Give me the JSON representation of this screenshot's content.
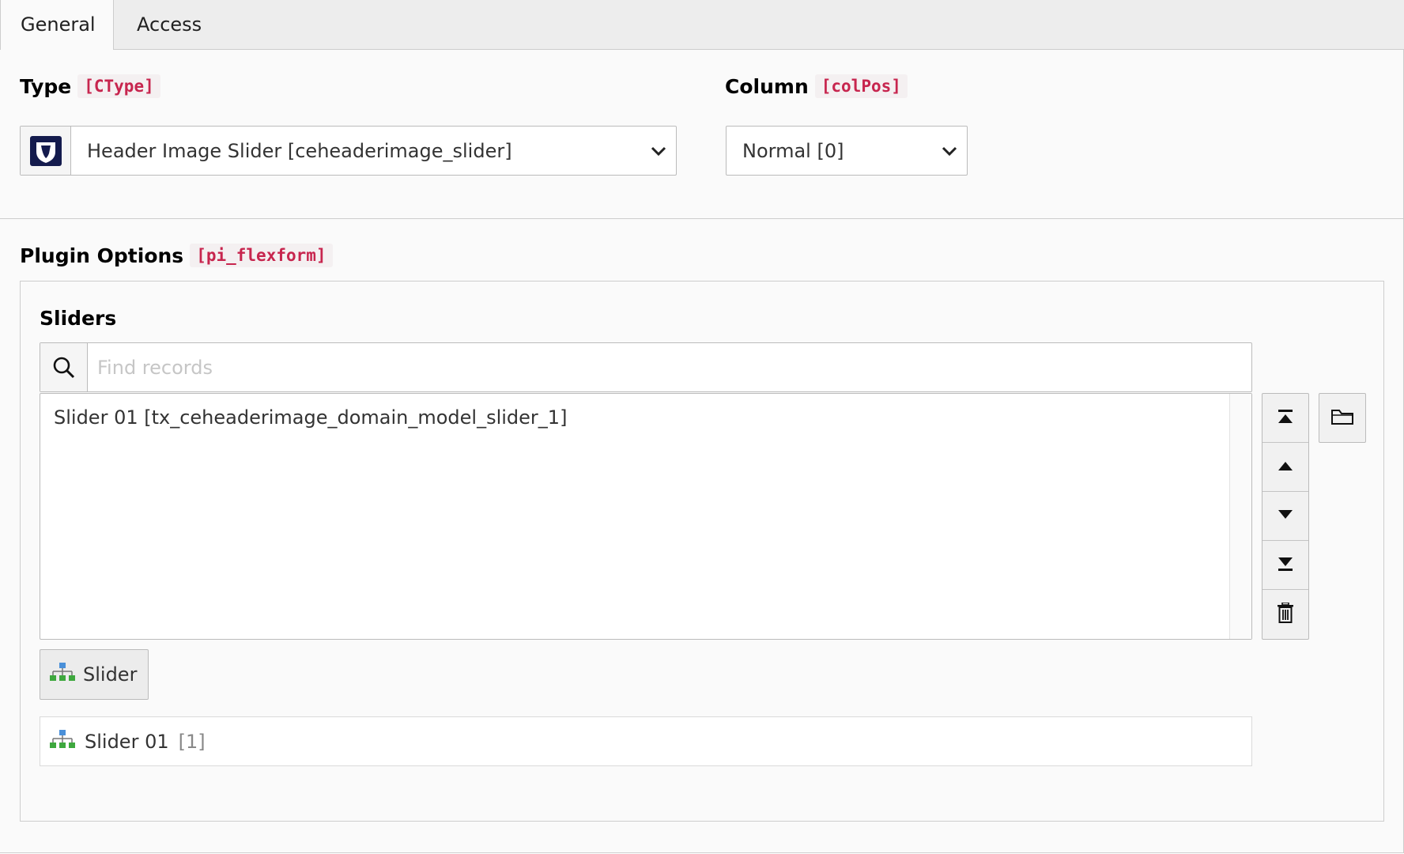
{
  "tabs": [
    {
      "label": "General",
      "active": true
    },
    {
      "label": "Access",
      "active": false
    }
  ],
  "type_field": {
    "label": "Type",
    "code": "[CType]",
    "value": "Header Image Slider [ceheaderimage_slider]",
    "icon": "typo3-shield-icon"
  },
  "column_field": {
    "label": "Column",
    "code": "[colPos]",
    "value": "Normal [0]"
  },
  "plugin_options": {
    "label": "Plugin Options",
    "code": "[pi_flexform]"
  },
  "sliders": {
    "label": "Sliders",
    "search_placeholder": "Find records",
    "selected_items": [
      "Slider 01 [tx_ceheaderimage_domain_model_slider_1]"
    ],
    "controls": [
      "move-to-top-icon",
      "move-up-icon",
      "move-down-icon",
      "move-to-bottom-icon",
      "trash-icon"
    ],
    "browse_icon": "folder-icon",
    "add_button_label": "Slider",
    "records": [
      {
        "title": "Slider 01",
        "uid": "[1]",
        "icon": "sitemap-icon"
      }
    ]
  },
  "colors": {
    "code_red": "#c7254e",
    "tab_bg": "#ededed",
    "panel_bg": "#fafafa"
  }
}
